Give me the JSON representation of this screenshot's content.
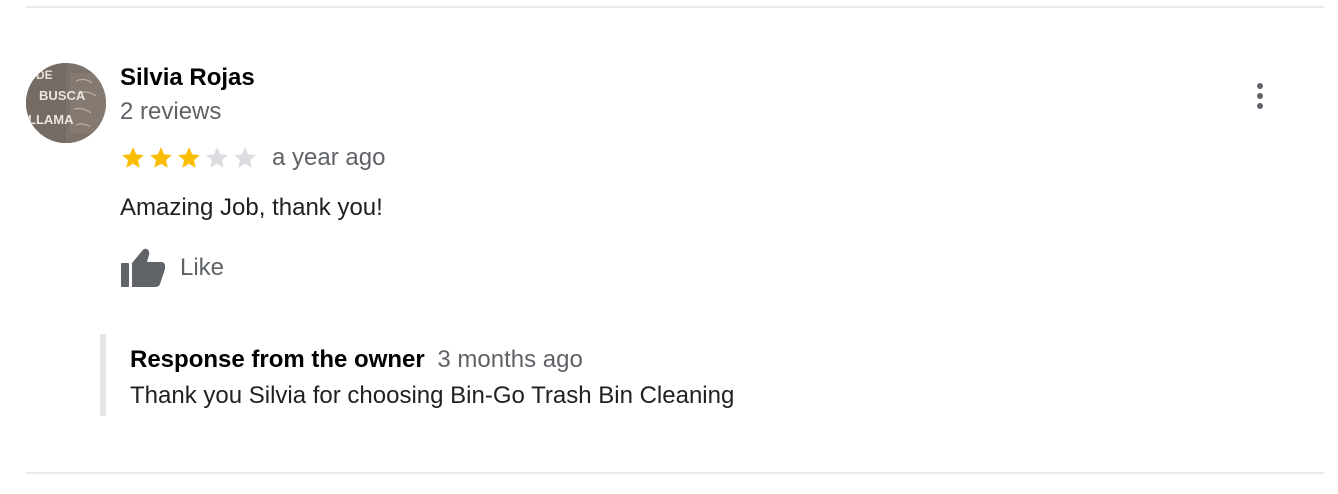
{
  "review": {
    "reviewer_name": "Silvia Rojas",
    "review_count": "2 reviews",
    "rating": 3,
    "max_rating": 5,
    "time_ago": "a year ago",
    "text": "Amazing Job, thank you!",
    "like_label": "Like",
    "avatar": {
      "lines": [
        "DE",
        "BUSCA",
        "LLAMA"
      ]
    }
  },
  "owner_response": {
    "label": "Response from the owner",
    "time_ago": "3 months ago",
    "text": "Thank you Silvia for choosing Bin-Go Trash Bin Cleaning"
  },
  "icons": {
    "more": "more-vert-icon",
    "like": "thumb-up-icon",
    "star": "star-icon"
  },
  "colors": {
    "star_filled": "#fbbc04",
    "star_empty": "#dadce0",
    "secondary_text": "#5f6368",
    "divider": "#ebebeb",
    "response_border": "#e5e5e5"
  }
}
